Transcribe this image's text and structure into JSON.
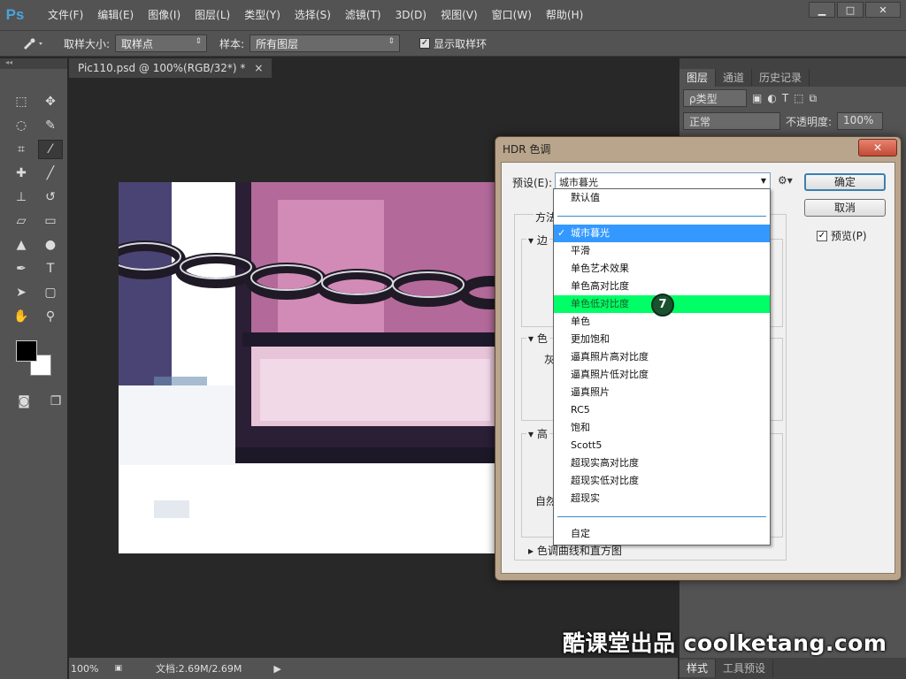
{
  "app": {
    "logo": "Ps"
  },
  "menubar": {
    "items": [
      "文件(F)",
      "编辑(E)",
      "图像(I)",
      "图层(L)",
      "类型(Y)",
      "选择(S)",
      "滤镜(T)",
      "3D(D)",
      "视图(V)",
      "窗口(W)",
      "帮助(H)"
    ]
  },
  "window_buttons": {
    "minimize": "▁",
    "maximize": "□",
    "close": "✕"
  },
  "options": {
    "sample_size_label": "取样大小:",
    "sample_size_value": "取样点",
    "sample_label": "样本:",
    "sample_value": "所有图层",
    "show_ring_label": "显示取样环",
    "show_ring_checked": true
  },
  "document": {
    "tab_title": "Pic110.psd @ 100%(RGB/32*) *",
    "tab_close": "×"
  },
  "status": {
    "zoom": "100%",
    "doc_info": "文档:2.69M/2.69M"
  },
  "layers_panel": {
    "tabs": [
      "图层",
      "通道",
      "历史记录"
    ],
    "filter_kind": "ρ类型",
    "blend_mode": "正常",
    "opacity_label": "不透明度:",
    "opacity_value": "100%"
  },
  "bottom_panel": {
    "tabs": [
      "样式",
      "工具预设"
    ]
  },
  "dialog": {
    "title": "HDR 色调",
    "close": "✕",
    "preset_label": "预设(E):",
    "preset_value": "城市暮光",
    "ok_button": "确定",
    "cancel_button": "取消",
    "preview_label": "预览(P)",
    "preview_checked": true,
    "method_label": "方法",
    "edge_label": "边",
    "tone_label": "色",
    "gray_label": "灰",
    "advanced_label": "高",
    "natural_label": "自然",
    "curve_label": "色调曲线和直方图"
  },
  "dropdown": {
    "items": [
      {
        "label": "默认值",
        "state": ""
      },
      {
        "label": "",
        "state": "separator"
      },
      {
        "label": "城市暮光",
        "state": "selected"
      },
      {
        "label": "平滑",
        "state": ""
      },
      {
        "label": "单色艺术效果",
        "state": ""
      },
      {
        "label": "单色高对比度",
        "state": ""
      },
      {
        "label": "单色低对比度",
        "state": "hilite"
      },
      {
        "label": "单色",
        "state": ""
      },
      {
        "label": "更加饱和",
        "state": ""
      },
      {
        "label": "逼真照片高对比度",
        "state": ""
      },
      {
        "label": "逼真照片低对比度",
        "state": ""
      },
      {
        "label": "逼真照片",
        "state": ""
      },
      {
        "label": "RC5",
        "state": ""
      },
      {
        "label": "饱和",
        "state": ""
      },
      {
        "label": "Scott5",
        "state": ""
      },
      {
        "label": "超现实高对比度",
        "state": ""
      },
      {
        "label": "超现实低对比度",
        "state": ""
      },
      {
        "label": "超现实",
        "state": ""
      },
      {
        "label": "",
        "state": "separator"
      },
      {
        "label": "自定",
        "state": ""
      }
    ],
    "step_badge": "7",
    "selected_check": "✓"
  },
  "watermark": "酷课堂出品 coolketang.com",
  "colors": {
    "selected": "#3399ff",
    "hilite": "#00ff66",
    "panel_bg": "#535353",
    "app_bg": "#282828"
  }
}
